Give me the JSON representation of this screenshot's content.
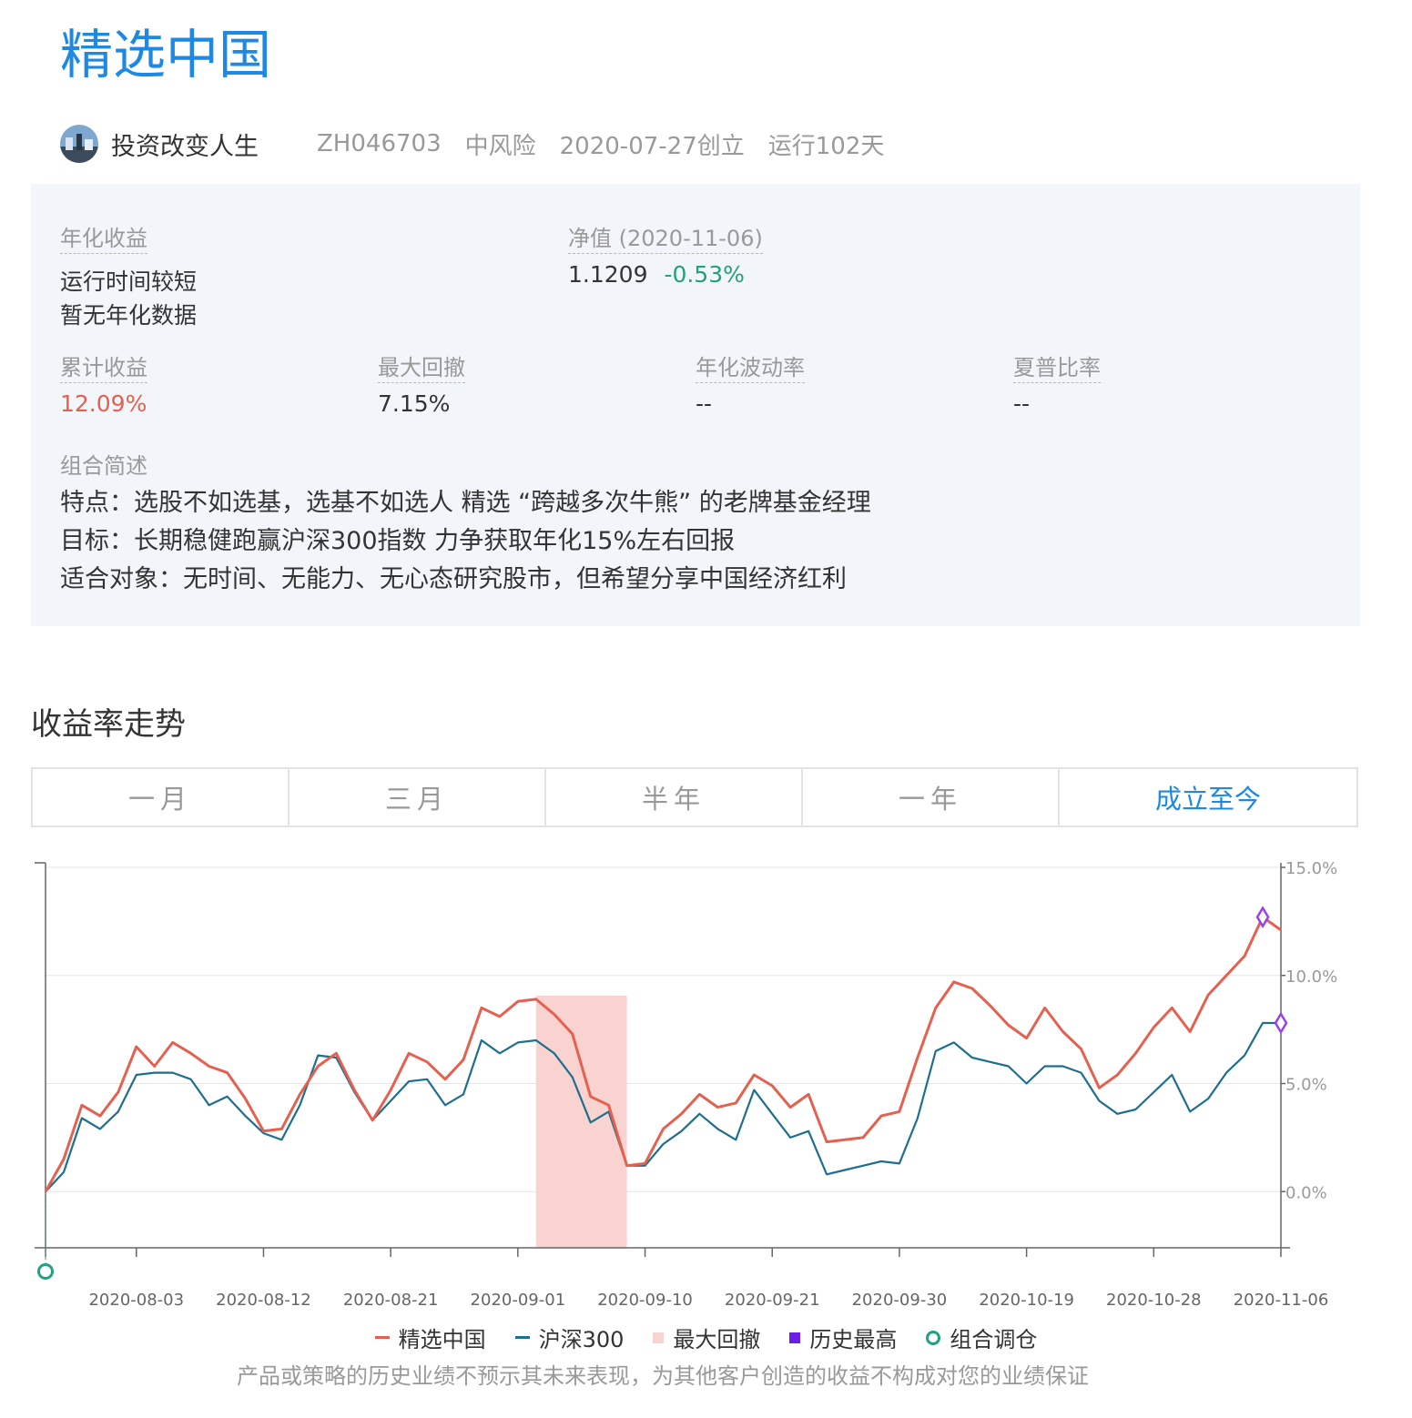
{
  "header": {
    "title": "精选中国",
    "owner_name": "投资改变人生",
    "code": "ZH046703",
    "risk": "中风险",
    "created": "2020-07-27创立",
    "running": "运行102天"
  },
  "stats": {
    "annual_label": "年化收益",
    "annual_line1": "运行时间较短",
    "annual_line2": "暂无年化数据",
    "nav_label": "净值 (2020-11-06)",
    "nav_value": "1.1209",
    "nav_change": "-0.53%",
    "cum_label": "累计收益",
    "cum_value": "12.09%",
    "mdd_label": "最大回撤",
    "mdd_value": "7.15%",
    "vol_label": "年化波动率",
    "vol_value": "--",
    "sharpe_label": "夏普比率",
    "sharpe_value": "--",
    "desc_label": "组合简述",
    "desc_lines": [
      "特点：选股不如选基，选基不如选人 精选 “跨越多次牛熊” 的老牌基金经理",
      "目标：长期稳健跑赢沪深300指数 力争获取年化15%左右回报",
      "适合对象：无时间、无能力、无心态研究股市，但希望分享中国经济红利"
    ]
  },
  "section_title": "收益率走势",
  "tabs": [
    {
      "label": "一月"
    },
    {
      "label": "三月"
    },
    {
      "label": "半年"
    },
    {
      "label": "一年"
    },
    {
      "label": "成立至今",
      "active": true
    }
  ],
  "chart_data": {
    "type": "line",
    "yaxis": {
      "ticks": [
        "15.0%",
        "10.0%",
        "5.0%",
        "0.0%"
      ],
      "values": [
        15,
        10,
        5,
        0
      ],
      "range": [
        -2.6,
        15
      ],
      "side": "right"
    },
    "xaxis": {
      "tick_labels": [
        "2020-08-03",
        "2020-08-12",
        "2020-08-21",
        "2020-09-01",
        "2020-09-10",
        "2020-09-21",
        "2020-09-30",
        "2020-10-19",
        "2020-10-28",
        "2020-11-06"
      ],
      "tick_index": [
        5,
        12,
        19,
        26,
        33,
        40,
        47,
        54,
        61,
        68
      ]
    },
    "points": 69,
    "series": [
      {
        "name": "精选中国",
        "color": "#e5604f",
        "values": [
          0,
          1.5,
          4.0,
          3.5,
          4.6,
          6.7,
          5.8,
          6.9,
          6.4,
          5.8,
          5.5,
          4.3,
          2.8,
          2.9,
          4.5,
          5.8,
          6.4,
          4.7,
          3.3,
          4.7,
          6.4,
          6.0,
          5.2,
          6.1,
          8.5,
          8.1,
          8.8,
          8.9,
          8.2,
          7.3,
          4.4,
          4.0,
          1.2,
          1.3,
          2.9,
          3.6,
          4.5,
          3.9,
          4.1,
          5.4,
          4.9,
          3.9,
          4.5,
          2.3,
          2.4,
          2.5,
          3.5,
          3.7,
          6.2,
          8.5,
          9.7,
          9.4,
          8.6,
          7.7,
          7.1,
          8.5,
          7.4,
          6.6,
          4.8,
          5.4,
          6.4,
          7.6,
          8.5,
          7.4,
          9.1,
          10.0,
          10.9,
          12.7,
          12.1
        ]
      },
      {
        "name": "沪深300",
        "color": "#1e6f8e",
        "values": [
          0,
          0.9,
          3.4,
          2.9,
          3.7,
          5.4,
          5.5,
          5.5,
          5.2,
          4.0,
          4.4,
          3.5,
          2.7,
          2.4,
          4.0,
          6.3,
          6.2,
          4.6,
          3.3,
          4.2,
          5.1,
          5.2,
          4.0,
          4.5,
          7.0,
          6.4,
          6.9,
          7.0,
          6.4,
          5.3,
          3.2,
          3.7,
          1.2,
          1.2,
          2.2,
          2.8,
          3.6,
          2.9,
          2.4,
          4.7,
          3.6,
          2.5,
          2.8,
          0.8,
          1.0,
          1.2,
          1.4,
          1.3,
          3.4,
          6.5,
          6.9,
          6.2,
          6.0,
          5.8,
          5.0,
          5.8,
          5.8,
          5.5,
          4.2,
          3.6,
          3.8,
          4.6,
          5.4,
          3.7,
          4.3,
          5.5,
          6.3,
          7.8,
          7.8
        ]
      }
    ],
    "max_drawdown_range": [
      27,
      32
    ],
    "historical_high_marks": [
      {
        "series": "精选中国",
        "index": 67
      },
      {
        "series": "沪深300",
        "index": 68
      }
    ],
    "rebalance_marks": [
      {
        "index": 0
      }
    ],
    "legend": [
      {
        "label": "精选中国",
        "color": "#e5604f",
        "kind": "line"
      },
      {
        "label": "沪深300",
        "color": "#1e6f8e",
        "kind": "line"
      },
      {
        "label": "最大回撤",
        "color": "#f9d3cf",
        "kind": "square"
      },
      {
        "label": "历史最高",
        "color": "#6a1ee8",
        "kind": "square"
      },
      {
        "label": "组合调仓",
        "color": "#22a17f",
        "kind": "circle"
      }
    ],
    "colors": {
      "drawdown": "#f9d3cf",
      "high": "#9b3ef0",
      "rebalance": "#22a17f",
      "grid": "#e6e6e6",
      "axis": "#666666"
    }
  },
  "disclaimer": "产品或策略的历史业绩不预示其未来表现，为其他客户创造的收益不构成对您的业绩保证"
}
